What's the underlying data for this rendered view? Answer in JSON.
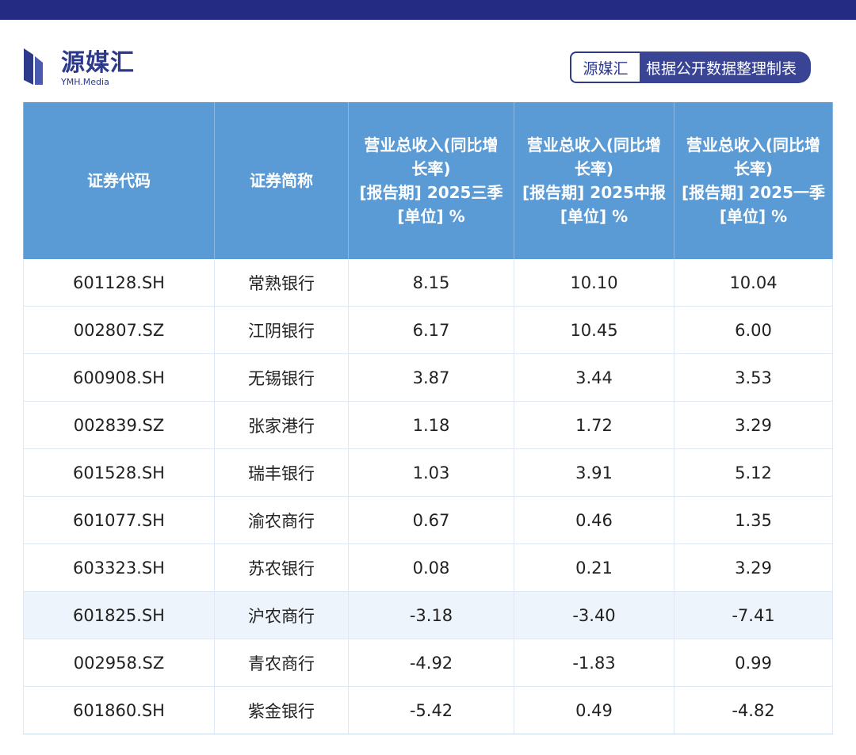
{
  "brand": {
    "logo_name": "源媒汇",
    "logo_sub": "YMH.Media",
    "tag_brand": "源媒汇",
    "tag_text": "根据公开数据整理制表",
    "accent": "#2d3a8c",
    "topbar_color": "#242b82"
  },
  "table": {
    "header_color": "#5b9bd5",
    "headers": {
      "code": "证券代码",
      "name": "证券简称",
      "q3": [
        "营业总收入(同比增",
        "长率)",
        "[报告期] 2025三季",
        "[单位] %"
      ],
      "h1": [
        "营业总收入(同比增",
        "长率)",
        "[报告期] 2025中报",
        "[单位] %"
      ],
      "q1": [
        "营业总收入(同比增",
        "长率)",
        "[报告期] 2025一季",
        "[单位] %"
      ]
    },
    "rows": [
      {
        "code": "601128.SH",
        "name": "常熟银行",
        "q3": "8.15",
        "h1": "10.10",
        "q1": "10.04"
      },
      {
        "code": "002807.SZ",
        "name": "江阴银行",
        "q3": "6.17",
        "h1": "10.45",
        "q1": "6.00"
      },
      {
        "code": "600908.SH",
        "name": "无锡银行",
        "q3": "3.87",
        "h1": "3.44",
        "q1": "3.53"
      },
      {
        "code": "002839.SZ",
        "name": "张家港行",
        "q3": "1.18",
        "h1": "1.72",
        "q1": "3.29"
      },
      {
        "code": "601528.SH",
        "name": "瑞丰银行",
        "q3": "1.03",
        "h1": "3.91",
        "q1": "5.12"
      },
      {
        "code": "601077.SH",
        "name": "渝农商行",
        "q3": "0.67",
        "h1": "0.46",
        "q1": "1.35"
      },
      {
        "code": "603323.SH",
        "name": "苏农银行",
        "q3": "0.08",
        "h1": "0.21",
        "q1": "3.29"
      },
      {
        "code": "601825.SH",
        "name": "沪农商行",
        "q3": "-3.18",
        "h1": "-3.40",
        "q1": "-7.41"
      },
      {
        "code": "002958.SZ",
        "name": "青农商行",
        "q3": "-4.92",
        "h1": "-1.83",
        "q1": "0.99"
      },
      {
        "code": "601860.SH",
        "name": "紫金银行",
        "q3": "-5.42",
        "h1": "0.49",
        "q1": "-4.82"
      }
    ]
  }
}
